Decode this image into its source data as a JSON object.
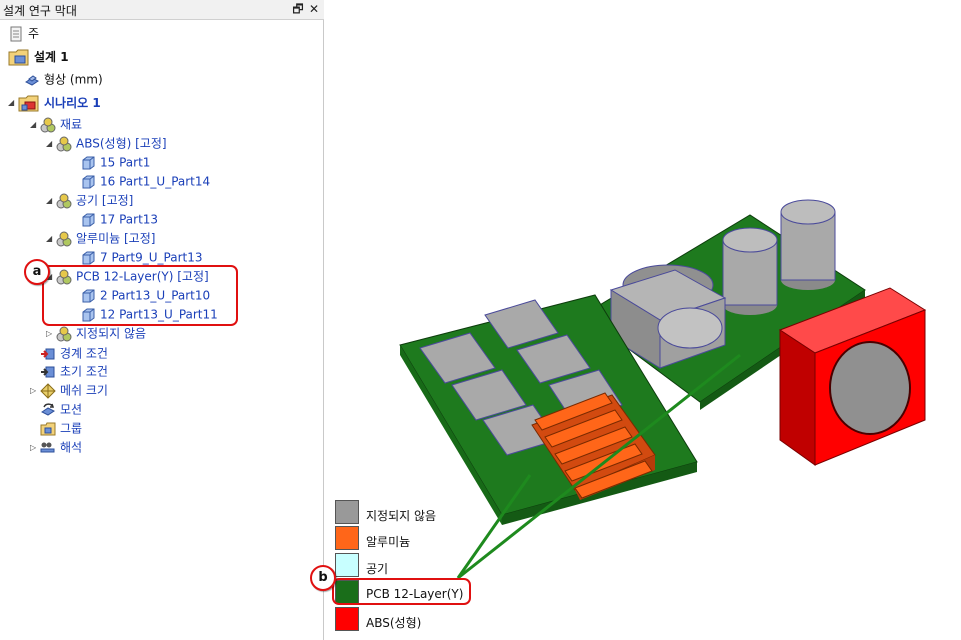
{
  "panel": {
    "title": "설계 연구 막대",
    "restore_glyph": "🗗",
    "close_glyph": "✕"
  },
  "tree": {
    "root": "주",
    "study": "설계 1",
    "geometry": "형상 (mm)",
    "scenario": "시나리오 1",
    "materials": "재료",
    "abs_group": "ABS(성형) [고정]",
    "abs_part1": "15 Part1",
    "abs_part2": "16 Part1_U_Part14",
    "air_group": "공기 [고정]",
    "air_part1": "17 Part13",
    "alu_group": "알루미늄 [고정]",
    "alu_part1": "7 Part9_U_Part13",
    "pcb_group": "PCB 12-Layer(Y) [고정]",
    "pcb_part1": "2 Part13_U_Part10",
    "pcb_part2": "12 Part13_U_Part11",
    "unassigned": "지정되지 않음",
    "boundary": "경계 조건",
    "initial": "초기 조건",
    "mesh": "메쉬 크기",
    "motion": "모션",
    "groups": "그룹",
    "solve": "해석"
  },
  "legend": [
    {
      "label": "지정되지 않음",
      "color": "#999999"
    },
    {
      "label": "알루미늄",
      "color": "#ff6619"
    },
    {
      "label": "공기",
      "color": "#c8ffff"
    },
    {
      "label": "PCB 12-Layer(Y)",
      "color": "#1a6e1a"
    },
    {
      "label": "ABS(성형)",
      "color": "#ff0000"
    }
  ],
  "callouts": {
    "a": "a",
    "b": "b"
  },
  "colors": {
    "highlight": "#e01010",
    "link_blue": "#1a3fb8",
    "leader_green": "#1e8a1e"
  }
}
